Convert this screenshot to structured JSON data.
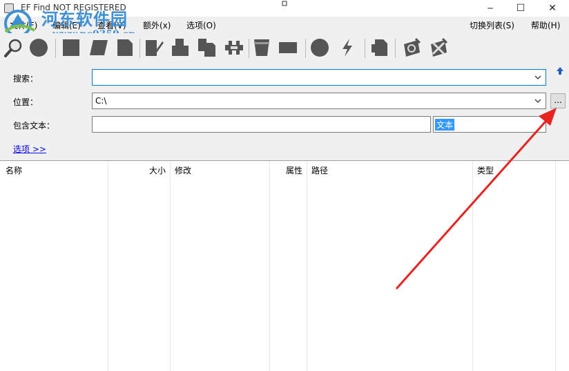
{
  "window": {
    "title": "EF Find NOT REGISTERED",
    "minimize_glyph": "─",
    "maximize_glyph": "☐",
    "close_glyph": "✕"
  },
  "watermark": {
    "title": "河东软件园",
    "url": "www.pc0359.cn"
  },
  "menu": {
    "file": "文件(F)",
    "edit": "编辑(E)",
    "view": "查看(V)",
    "extra": "额外(x)",
    "options": "选项(O)",
    "switch_list": "切换列表(S)",
    "help": "帮助(H)"
  },
  "toolbar": {
    "icons": [
      "magnifier-icon",
      "circle-icon",
      "square-icon",
      "parallelogram-icon",
      "page-icon",
      "page-edit-icon",
      "page-split-icon",
      "pages-icon",
      "caliper-icon",
      "cup-icon",
      "chip-icon",
      "ball-icon",
      "bolt-icon",
      "folder-page-icon",
      "gear-page-icon",
      "gear-tool-icon"
    ]
  },
  "form": {
    "search_label": "搜索：",
    "search_value": "",
    "location_label": "位置：",
    "location_value": "C:\\",
    "contains_label": "包含文本：",
    "contains_value": "",
    "text_type": "文本",
    "browse_label": "...",
    "options_link": "选项 >>"
  },
  "list": {
    "columns": [
      "名称",
      "大小",
      "修改",
      "属性",
      "路径",
      "类型"
    ]
  },
  "colors": {
    "annotation_arrow": "#e8231f",
    "link": "#0000ee",
    "selection": "#3399ff",
    "watermark": "#3d8fd6"
  }
}
